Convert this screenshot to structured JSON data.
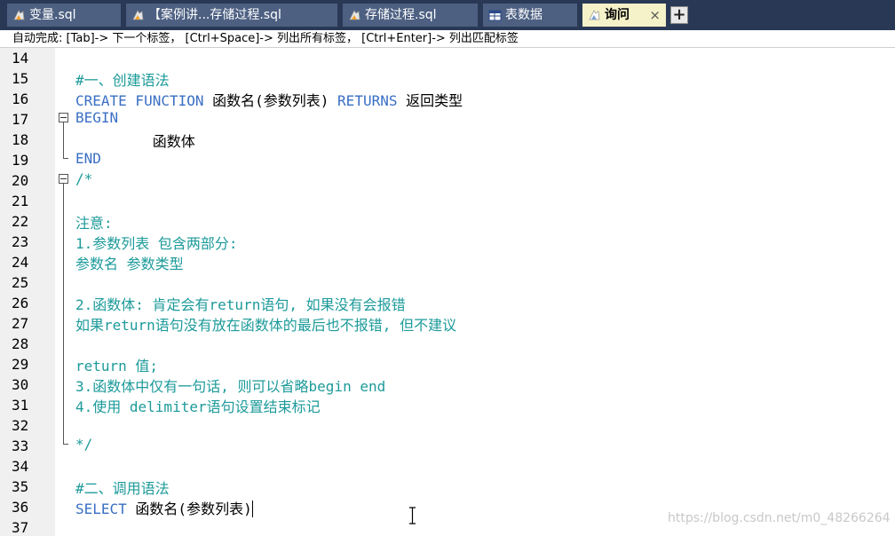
{
  "tabs": [
    {
      "label": "变量.sql",
      "icon": "sql-file-icon",
      "active": false
    },
    {
      "label": "【案例讲...存储过程.sql",
      "icon": "sql-file-icon",
      "active": false
    },
    {
      "label": "存储过程.sql",
      "icon": "sql-file-icon",
      "active": false
    },
    {
      "label": "表数据",
      "icon": "table-icon",
      "active": false
    },
    {
      "label": "询问",
      "icon": "query-icon",
      "active": true,
      "close": "×"
    }
  ],
  "add_tab": "+",
  "hint": "自动完成: [Tab]-> 下一个标签， [Ctrl+Space]-> 列出所有标签， [Ctrl+Enter]-> 列出匹配标签",
  "line_numbers": [
    "14",
    "15",
    "16",
    "17",
    "18",
    "19",
    "20",
    "21",
    "22",
    "23",
    "24",
    "25",
    "26",
    "27",
    "28",
    "29",
    "30",
    "31",
    "32",
    "33",
    "34",
    "35",
    "36",
    "37"
  ],
  "code": {
    "l15": "#一、创建语法",
    "l16_kw1": "CREATE FUNCTION",
    "l16_t1": " 函数名(参数列表) ",
    "l16_kw2": "RETURNS",
    "l16_t2": " 返回类型",
    "l17": "BEGIN",
    "l18": "         函数体",
    "l19": "END",
    "l20": "/*",
    "l22": "注意:",
    "l23": "1.参数列表 包含两部分:",
    "l24": "参数名 参数类型",
    "l26": "2.函数体: 肯定会有return语句, 如果没有会报错",
    "l27": "如果return语句没有放在函数体的最后也不报错, 但不建议",
    "l29": "return 值;",
    "l30": "3.函数体中仅有一句话, 则可以省略begin end",
    "l31": "4.使用 delimiter语句设置结束标记",
    "l33": "*/",
    "l35": "#二、调用语法",
    "l36_kw": "SELECT",
    "l36_t": " 函数名(参数列表)"
  },
  "watermark": "https://blog.csdn.net/m0_48266264",
  "colors": {
    "keyword": "#3a6fc4",
    "comment": "#1d9a9a",
    "tabbar": "#293955",
    "active_tab": "#f5f1c8"
  }
}
